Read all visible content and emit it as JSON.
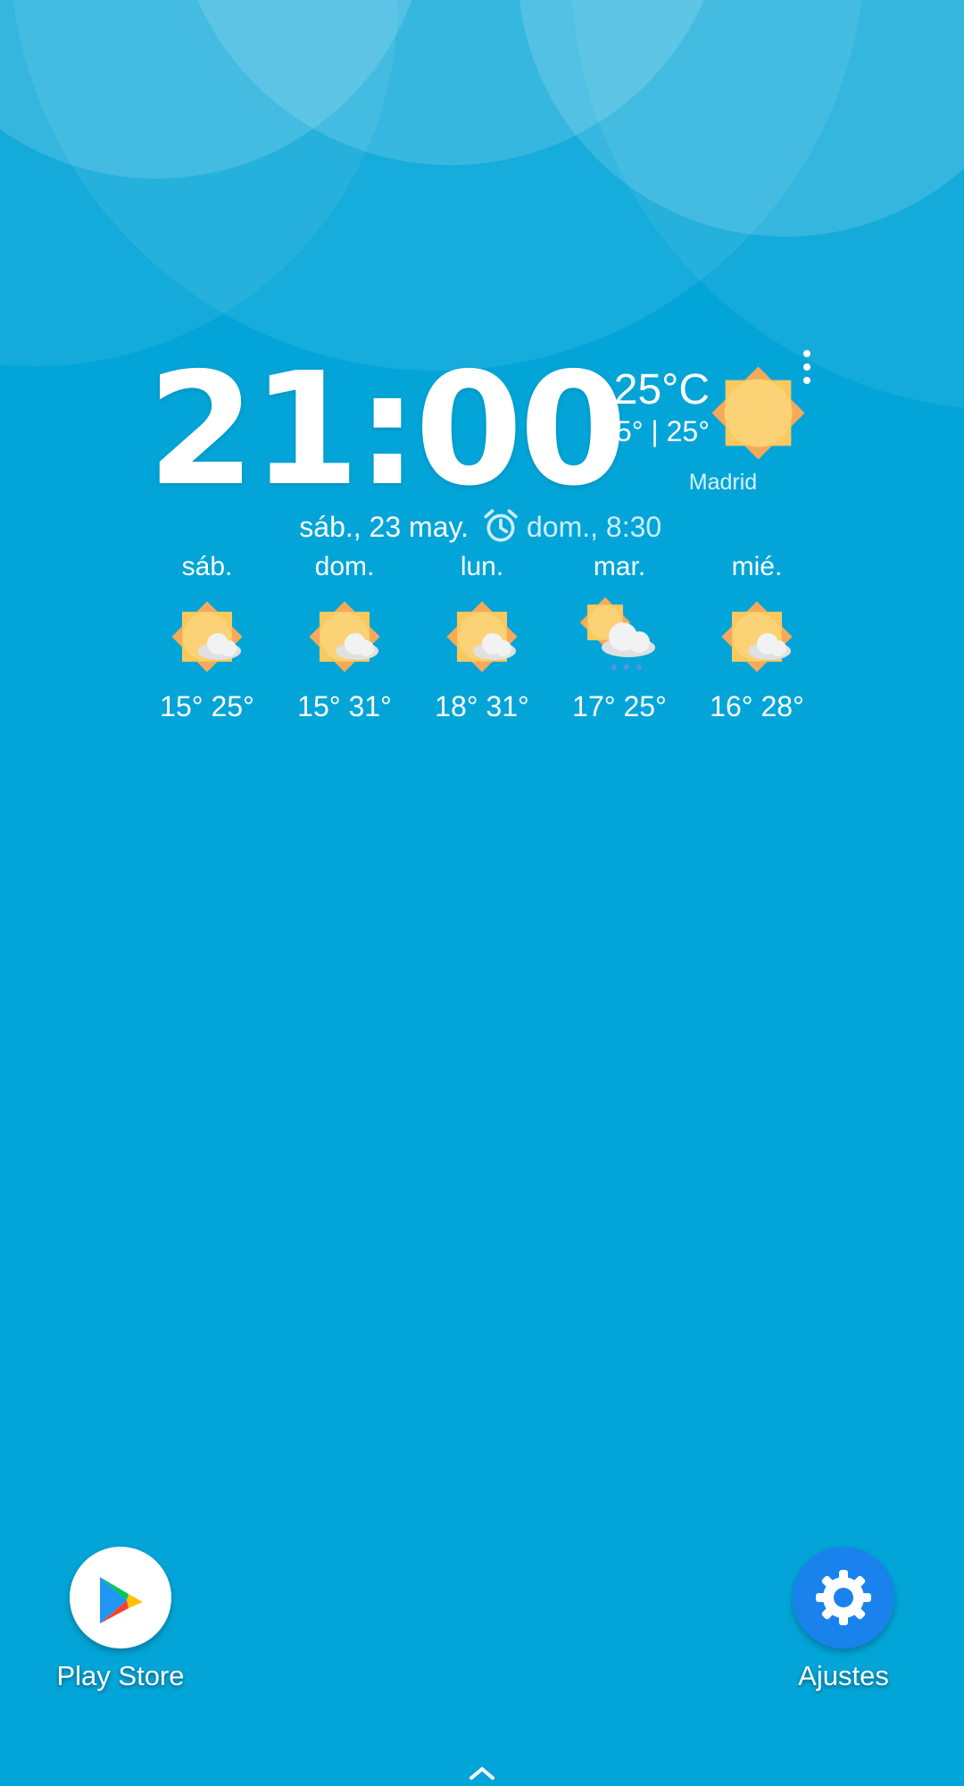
{
  "clock": {
    "time": "21:00"
  },
  "weather": {
    "current_temp": "25°C",
    "range": "15° | 25°",
    "city": "Madrid",
    "icon": "sun-icon"
  },
  "date": {
    "text": "sáb., 23 may.",
    "alarm": "dom., 8:30"
  },
  "forecast": [
    {
      "day": "sáb.",
      "temps": "15° 25°",
      "icon": "sun-cloud-icon"
    },
    {
      "day": "dom.",
      "temps": "15° 31°",
      "icon": "sun-cloud-icon"
    },
    {
      "day": "lun.",
      "temps": "18° 31°",
      "icon": "sun-cloud-icon"
    },
    {
      "day": "mar.",
      "temps": "17° 25°",
      "icon": "sun-cloud-rain-icon"
    },
    {
      "day": "mié.",
      "temps": "16° 28°",
      "icon": "sun-cloud-icon"
    }
  ],
  "dock": {
    "left": {
      "label": "Play Store",
      "icon": "play-store-icon"
    },
    "right": {
      "label": "Ajustes",
      "icon": "settings-gear-icon"
    }
  },
  "colors": {
    "background": "#03a5d8",
    "sun": "#fcd277",
    "sun_shadow": "#f6a958",
    "settings": "#1a82ec"
  }
}
